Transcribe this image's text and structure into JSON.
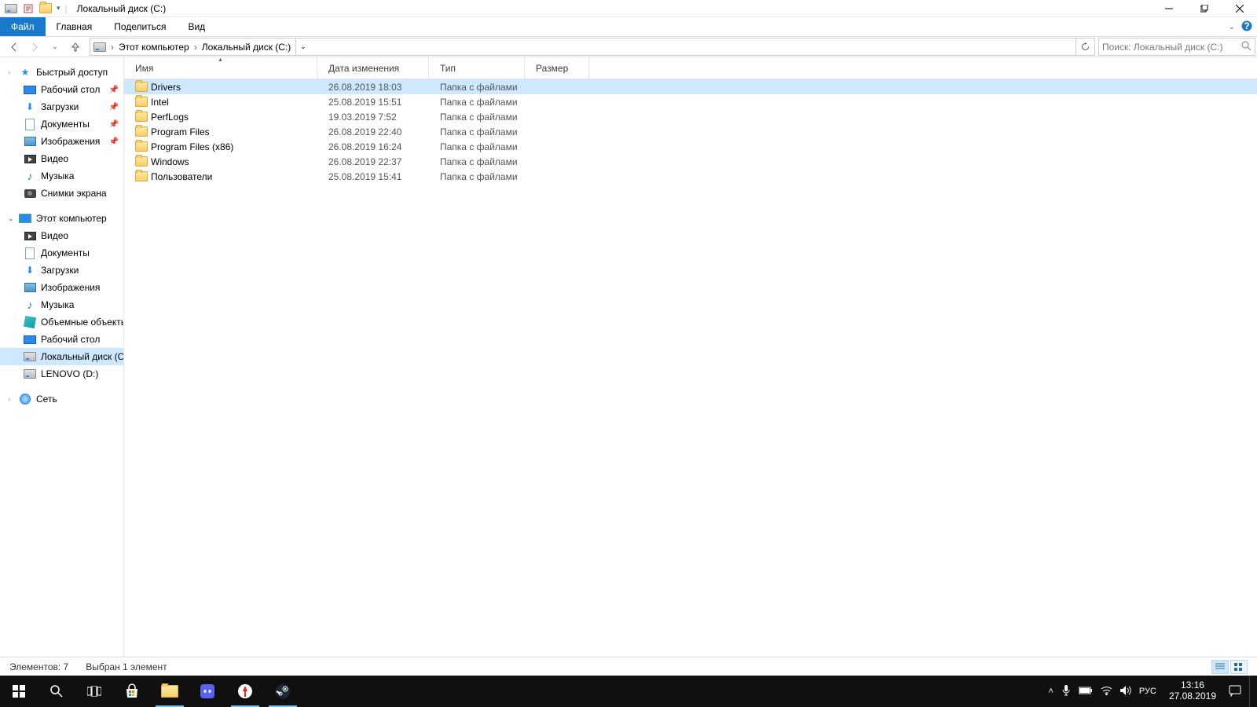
{
  "window": {
    "title": "Локальный диск (C:)"
  },
  "ribbon": {
    "file": "Файл",
    "home": "Главная",
    "share": "Поделиться",
    "view": "Вид"
  },
  "breadcrumb": {
    "root": "Этот компьютер",
    "current": "Локальный диск (C:)"
  },
  "search": {
    "placeholder": "Поиск: Локальный диск (C:)"
  },
  "columns": {
    "name": "Имя",
    "date": "Дата изменения",
    "type": "Тип",
    "size": "Размер"
  },
  "nav": {
    "quick_access": "Быстрый доступ",
    "desktop": "Рабочий стол",
    "downloads": "Загрузки",
    "documents": "Документы",
    "pictures": "Изображения",
    "video": "Видео",
    "music": "Музыка",
    "screenshots": "Снимки экрана",
    "this_pc": "Этот компьютер",
    "pc_video": "Видео",
    "pc_documents": "Документы",
    "pc_downloads": "Загрузки",
    "pc_pictures": "Изображения",
    "pc_music": "Музыка",
    "pc_3d": "Объемные объекты",
    "pc_desktop": "Рабочий стол",
    "pc_cdrive": "Локальный диск (C:)",
    "pc_ddrive": "LENOVO (D:)",
    "network": "Сеть"
  },
  "files": [
    {
      "name": "Drivers",
      "date": "26.08.2019 18:03",
      "type": "Папка с файлами",
      "size": "",
      "selected": true
    },
    {
      "name": "Intel",
      "date": "25.08.2019 15:51",
      "type": "Папка с файлами",
      "size": "",
      "selected": false
    },
    {
      "name": "PerfLogs",
      "date": "19.03.2019 7:52",
      "type": "Папка с файлами",
      "size": "",
      "selected": false
    },
    {
      "name": "Program Files",
      "date": "26.08.2019 22:40",
      "type": "Папка с файлами",
      "size": "",
      "selected": false
    },
    {
      "name": "Program Files (x86)",
      "date": "26.08.2019 16:24",
      "type": "Папка с файлами",
      "size": "",
      "selected": false
    },
    {
      "name": "Windows",
      "date": "26.08.2019 22:37",
      "type": "Папка с файлами",
      "size": "",
      "selected": false
    },
    {
      "name": "Пользователи",
      "date": "25.08.2019 15:41",
      "type": "Папка с файлами",
      "size": "",
      "selected": false
    }
  ],
  "status": {
    "count": "Элементов: 7",
    "selected": "Выбран 1 элемент"
  },
  "tray": {
    "lang": "РУС",
    "time": "13:16",
    "date": "27.08.2019"
  }
}
